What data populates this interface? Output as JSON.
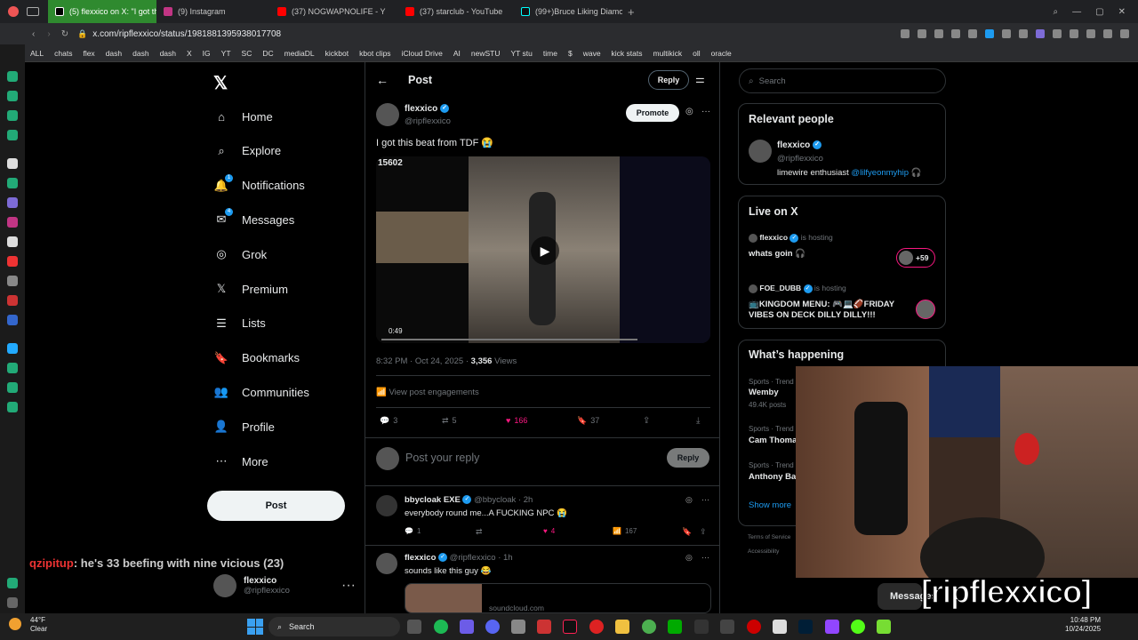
{
  "tabs": [
    {
      "label": "(5) flexxico on X: \"I got th",
      "color": "#000"
    },
    {
      "label": "(9) Instagram",
      "color": "#c13584"
    },
    {
      "label": "(37) NOGWAPNOLIFE - Y",
      "color": "#ff0000"
    },
    {
      "label": "(37) starclub - YouTube",
      "color": "#ff0000"
    },
    {
      "label": "(99+)Bruce Liking Diamo",
      "color": "#222"
    }
  ],
  "url": "x.com/ripflexxico/status/1981881395938017708",
  "bookmarks": [
    "ALL",
    "chats",
    "flex",
    "dash",
    "dash",
    "dash",
    "X",
    "IG",
    "YT",
    "SC",
    "DC",
    "mediaDL",
    "kickbot",
    "kbot clips",
    "iCloud Drive",
    "AI",
    "newSTU",
    "YT stu",
    "time",
    "$",
    "wave",
    "kick stats",
    "multikick",
    "oll",
    "oracle"
  ],
  "nav": [
    {
      "label": "Home",
      "icon": "home-icon"
    },
    {
      "label": "Explore",
      "icon": "search-icon"
    },
    {
      "label": "Notifications",
      "icon": "bell-icon",
      "badge": "1"
    },
    {
      "label": "Messages",
      "icon": "mail-icon",
      "badge": "4"
    },
    {
      "label": "Grok",
      "icon": "grok-icon"
    },
    {
      "label": "Premium",
      "icon": "x-logo-icon"
    },
    {
      "label": "Lists",
      "icon": "list-icon"
    },
    {
      "label": "Bookmarks",
      "icon": "bookmark-icon"
    },
    {
      "label": "Communities",
      "icon": "people-icon"
    },
    {
      "label": "Profile",
      "icon": "person-icon"
    },
    {
      "label": "More",
      "icon": "more-icon"
    }
  ],
  "post_button": "Post",
  "chat_overlay": {
    "user": "qzipitup",
    "text": ": he's 33 beefing with nine vicious (23)"
  },
  "account": {
    "name": "flexxico",
    "handle": "@ripflexxico"
  },
  "header": {
    "title": "Post",
    "reply": "Reply"
  },
  "post": {
    "name": "flexxico",
    "handle": "@ripflexxico",
    "promote": "Promote",
    "text": "I got this beat from TDF 😭",
    "video_counter": "15602",
    "video_time": "0:49",
    "timestamp": "8:32 PM · Oct 24, 2025 · ",
    "views_count": "3,356",
    "views_label": " Views",
    "engagements": "View post engagements",
    "stats": {
      "replies": "3",
      "reposts": "5",
      "likes": "166",
      "bookmarks": "37"
    }
  },
  "reply_box": {
    "placeholder": "Post your reply",
    "button": "Reply"
  },
  "replies": [
    {
      "name": "bbycloak EXE",
      "handle": "@bbycloak · 2h",
      "text": "everybody round me...A FUCKING NPC 😭",
      "replies": "1",
      "likes": "4",
      "views": "167"
    },
    {
      "name": "flexxico",
      "handle": "@ripflexxico · 1h",
      "text": "sounds like this guy 😂",
      "link": "soundcloud.com"
    }
  ],
  "search": {
    "placeholder": "Search"
  },
  "relevant": {
    "title": "Relevant people",
    "name": "flexxico",
    "handle": "@ripflexxico",
    "bio": "limewire enthusiast ",
    "bio_link": "@lilfyeonmyhip",
    "bio_end": " 🎧"
  },
  "live": {
    "title": "Live on X",
    "items": [
      {
        "host": "flexxico",
        "suffix": " is hosting",
        "title": "whats goin 🎧",
        "count": "+59"
      },
      {
        "host": "FOE_DUBB",
        "suffix": " is hosting",
        "title": "📺KINGDOM MENU: 🎮💻🏈FRIDAY VIBES ON DECK DILLY DILLY!!!"
      }
    ]
  },
  "happening": {
    "title": "What’s happening",
    "items": [
      {
        "cat": "Sports · Trend",
        "title": "Wemby",
        "sub": "49.4K posts"
      },
      {
        "cat": "Sports · Trend",
        "title": "Cam Thoma"
      },
      {
        "cat": "Sports · Trend",
        "title": "Anthony Ba"
      }
    ],
    "show_more": "Show more"
  },
  "footer": {
    "terms": "Terms of Service",
    "access": "Accessibility"
  },
  "stream": {
    "messages": "Messages",
    "overlay": "[ripflexxico]"
  },
  "taskbar": {
    "temp": "44°F",
    "weather": "Clear",
    "search": "Search",
    "time": "10:48 PM",
    "date": "10/24/2025"
  },
  "colors": {
    "accent": "#1d9bf0",
    "like": "#f91880",
    "tab_active": "#2f8a2f"
  }
}
